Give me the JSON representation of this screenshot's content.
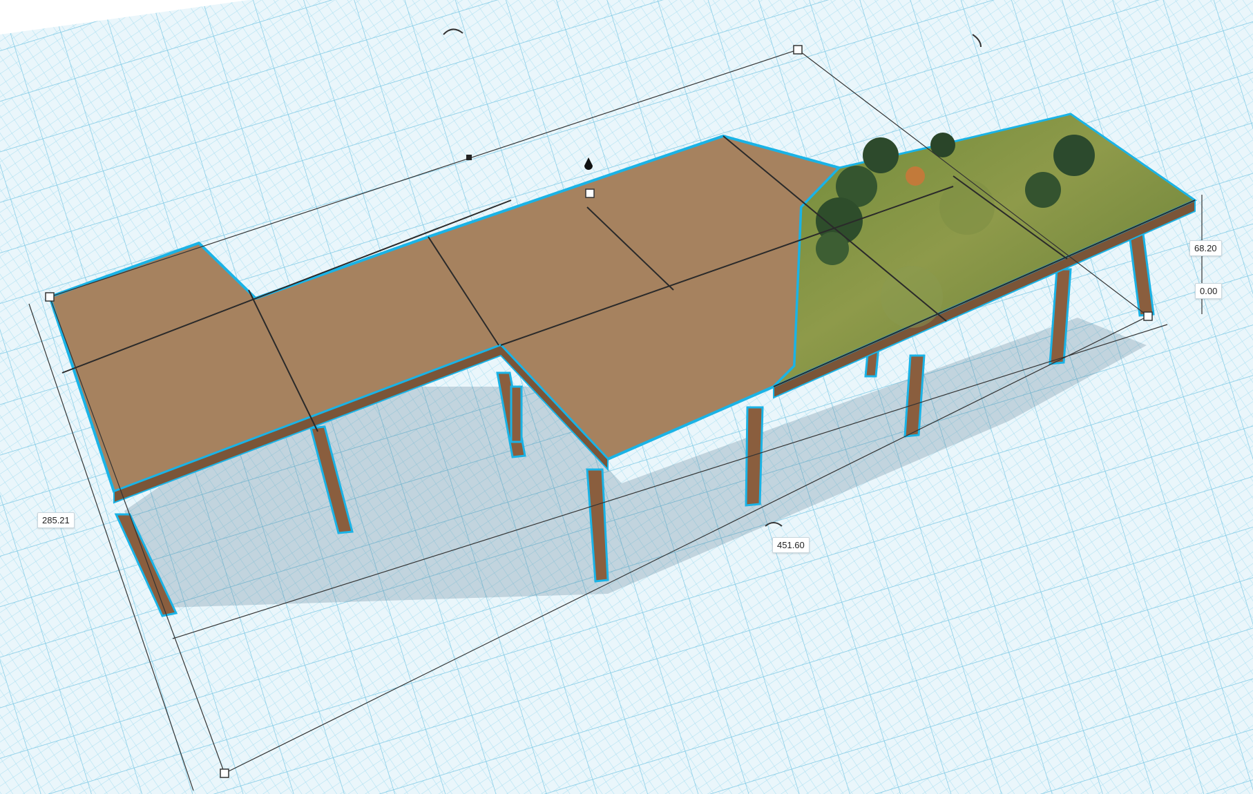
{
  "workplane": {
    "grid_color": "#8fd3ea",
    "background": "#eaf6fb"
  },
  "model": {
    "deck_color": "#a6825f",
    "leg_color": "#8a5e3e",
    "outline_color": "#1ab3e6",
    "terrain_image": "hillside-with-trees"
  },
  "dimensions": {
    "length": "451.60",
    "width": "285.21",
    "height": "68.20",
    "elevation": "0.00"
  },
  "handles": {
    "rotate_icon": "rotate-arrow-icon",
    "lift_icon": "drop-lift-icon",
    "resize_icon": "square-resize-handle-icon"
  }
}
